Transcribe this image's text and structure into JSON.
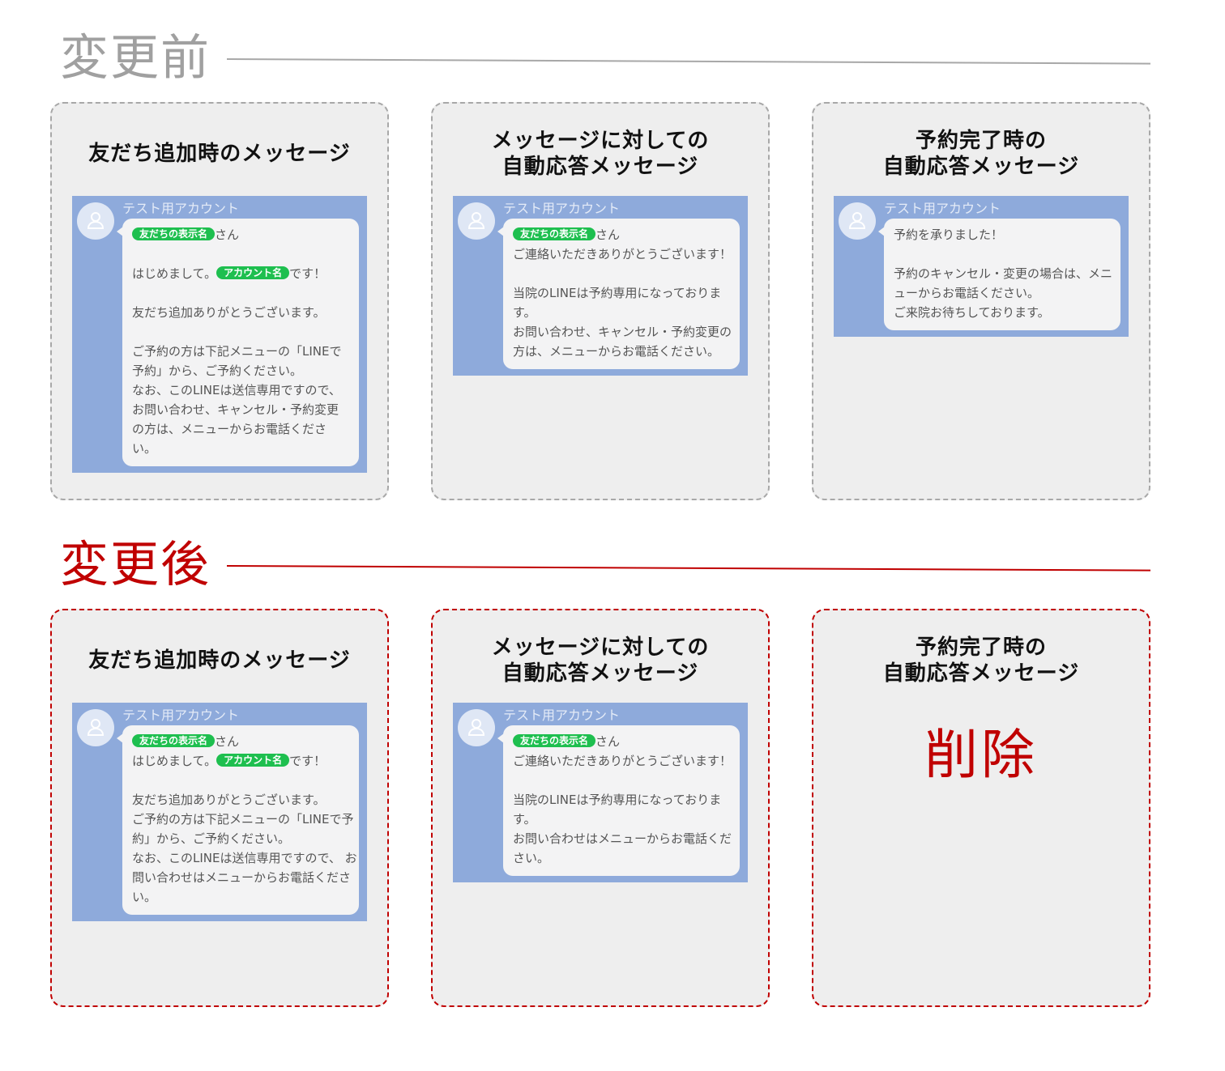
{
  "colors": {
    "before": "#a8a8a8",
    "after": "#c00000",
    "chat_bg": "#8eaadb",
    "tag": "#1ebf4f"
  },
  "before": {
    "heading": "変更前",
    "panels": [
      {
        "title": [
          "友だち追加時のメッセージ"
        ],
        "sender": "テスト用アカウント",
        "tag1": "友だちの表示名",
        "san": "さん",
        "hello": "はじめまして。",
        "tag2": "アカウント名",
        "desu": "です！",
        "lines": [
          "友だち追加ありがとうございます。",
          "ご予約の方は下記メニューの「LINEで",
          "予約」から、ご予約ください。",
          "なお、このLINEは送信専用ですので、",
          "お問い合わせ、キャンセル・予約変更",
          "の方は、メニューからお電話くださ",
          "い。"
        ]
      },
      {
        "title": [
          "メッセージに対しての",
          "自動応答メッセージ"
        ],
        "sender": "テスト用アカウント",
        "tag1": "友だちの表示名",
        "san": "さん",
        "lines": [
          "ご連絡いただきありがとうございます！",
          "当院のLINEは予約専用になっておりま",
          "す。",
          "お問い合わせ、キャンセル・予約変更の",
          "方は、メニューからお電話ください。"
        ]
      },
      {
        "title": [
          "予約完了時の",
          "自動応答メッセージ"
        ],
        "sender": "テスト用アカウント",
        "lines": [
          "予約を承りました！",
          "予約のキャンセル・変更の場合は、メニ",
          "ューからお電話ください。",
          "ご来院お待ちしております。"
        ]
      }
    ]
  },
  "after": {
    "heading": "変更後",
    "panels": [
      {
        "title": [
          "友だち追加時のメッセージ"
        ],
        "sender": "テスト用アカウント",
        "tag1": "友だちの表示名",
        "san": "さん",
        "hello": "はじめまして。",
        "tag2": "アカウント名",
        "desu": "です！",
        "lines": [
          "友だち追加ありがとうございます。",
          "ご予約の方は下記メニューの「LINEで予",
          "約」から、ご予約ください。",
          "なお、このLINEは送信専用ですので、 お",
          "問い合わせはメニューからお電話くださ",
          "い。"
        ]
      },
      {
        "title": [
          "メッセージに対しての",
          "自動応答メッセージ"
        ],
        "sender": "テスト用アカウント",
        "tag1": "友だちの表示名",
        "san": "さん",
        "lines": [
          "ご連絡いただきありがとうございます！",
          "当院のLINEは予約専用になっておりま",
          "す。",
          "お問い合わせはメニューからお電話くだ",
          "さい。"
        ]
      },
      {
        "title": [
          "予約完了時の",
          "自動応答メッセージ"
        ],
        "deleted_label": "削除"
      }
    ]
  }
}
